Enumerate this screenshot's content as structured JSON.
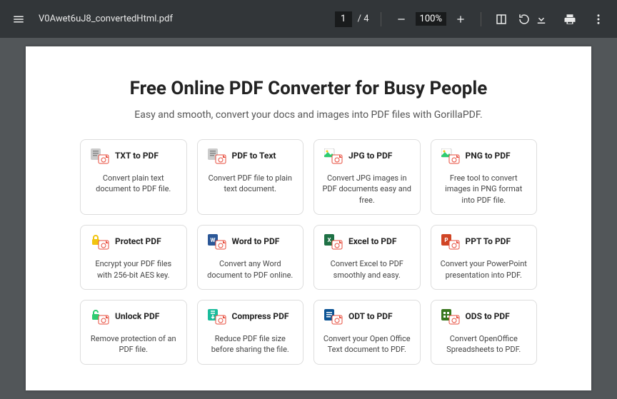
{
  "toolbar": {
    "filename": "V0Awet6uJ8_convertedHtml.pdf",
    "page_current": "1",
    "page_total": "/ 4",
    "zoom": "100%"
  },
  "page": {
    "title": "Free Online PDF Converter for Busy People",
    "subtitle": "Easy and smooth, convert your docs and images into PDF files with GorillaPDF."
  },
  "cards": [
    {
      "icon": "txt",
      "title": "TXT to PDF",
      "desc": "Convert plain text document to PDF file."
    },
    {
      "icon": "txt",
      "title": "PDF to Text",
      "desc": "Convert PDF file to plain text document."
    },
    {
      "icon": "img",
      "title": "JPG to PDF",
      "desc": "Convert JPG images in PDF documents easy and free."
    },
    {
      "icon": "img",
      "title": "PNG to PDF",
      "desc": "Free tool to convert images in PNG format into PDF file."
    },
    {
      "icon": "lock",
      "title": "Protect PDF",
      "desc": "Encrypt your PDF files with 256-bit AES key."
    },
    {
      "icon": "word",
      "title": "Word to PDF",
      "desc": "Convert any Word document to PDF online."
    },
    {
      "icon": "excel",
      "title": "Excel to PDF",
      "desc": "Convert Excel to PDF smoothly and easy."
    },
    {
      "icon": "ppt",
      "title": "PPT To PDF",
      "desc": "Convert your PowerPoint presentation into PDF."
    },
    {
      "icon": "unlock",
      "title": "Unlock PDF",
      "desc": "Remove protection of an PDF file."
    },
    {
      "icon": "compress",
      "title": "Compress PDF",
      "desc": "Reduce PDF file size before sharing the file."
    },
    {
      "icon": "odt",
      "title": "ODT to PDF",
      "desc": "Convert your Open Office Text document to PDF."
    },
    {
      "icon": "ods",
      "title": "ODS to PDF",
      "desc": "Convert OpenOffice Spreadsheets to PDF."
    }
  ]
}
